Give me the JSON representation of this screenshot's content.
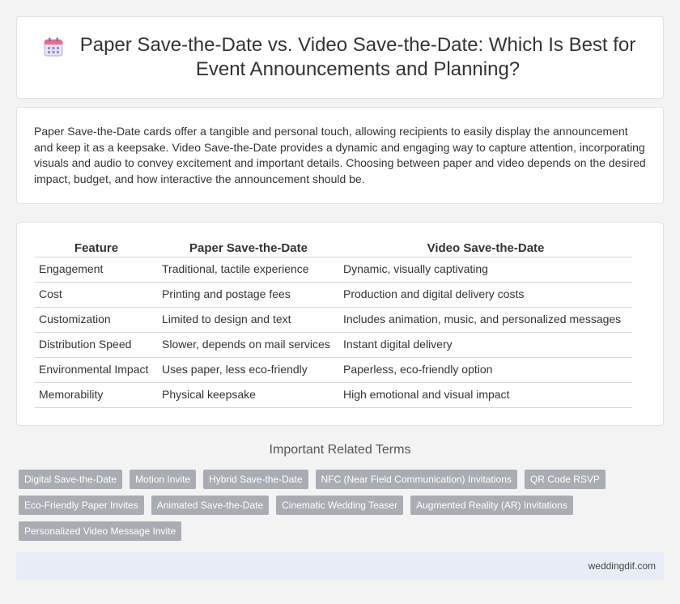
{
  "header": {
    "title": "Paper Save-the-Date vs. Video Save-the-Date: Which Is Best for Event Announcements and Planning?",
    "icon": "calendar-icon"
  },
  "intro": {
    "text": "Paper Save-the-Date cards offer a tangible and personal touch, allowing recipients to easily display the announcement and keep it as a keepsake. Video Save-the-Date provides a dynamic and engaging way to capture attention, incorporating visuals and audio to convey excitement and important details. Choosing between paper and video depends on the desired impact, budget, and how interactive the announcement should be."
  },
  "table": {
    "headers": [
      "Feature",
      "Paper Save-the-Date",
      "Video Save-the-Date"
    ],
    "rows": [
      [
        "Engagement",
        "Traditional, tactile experience",
        "Dynamic, visually captivating"
      ],
      [
        "Cost",
        "Printing and postage fees",
        "Production and digital delivery costs"
      ],
      [
        "Customization",
        "Limited to design and text",
        "Includes animation, music, and personalized messages"
      ],
      [
        "Distribution Speed",
        "Slower, depends on mail services",
        "Instant digital delivery"
      ],
      [
        "Environmental Impact",
        "Uses paper, less eco-friendly",
        "Paperless, eco-friendly option"
      ],
      [
        "Memorability",
        "Physical keepsake",
        "High emotional and visual impact"
      ]
    ]
  },
  "related": {
    "heading": "Important Related Terms",
    "tags": [
      "Digital Save-the-Date",
      "Motion Invite",
      "Hybrid Save-the-Date",
      "NFC (Near Field Communication) Invitations",
      "QR Code RSVP",
      "Eco-Friendly Paper Invites",
      "Animated Save-the-Date",
      "Cinematic Wedding Teaser",
      "Augmented Reality (AR) Invitations",
      "Personalized Video Message Invite"
    ]
  },
  "footer": {
    "site": "weddingdif.com"
  },
  "colors": {
    "tag_bg": "#a9adb3",
    "footer_bg": "#e8edf5",
    "page_bg": "#f3f3f3"
  }
}
